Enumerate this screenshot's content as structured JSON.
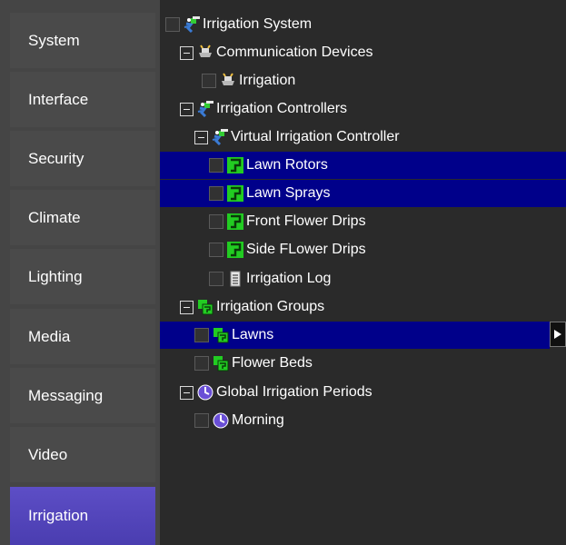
{
  "sidebar": {
    "items": [
      {
        "label": "System"
      },
      {
        "label": "Interface"
      },
      {
        "label": "Security"
      },
      {
        "label": "Climate"
      },
      {
        "label": "Lighting"
      },
      {
        "label": "Media"
      },
      {
        "label": "Messaging"
      },
      {
        "label": "Video"
      },
      {
        "label": "Irrigation",
        "active": true
      }
    ]
  },
  "tree": {
    "rows": [
      {
        "label": "Irrigation System",
        "icon": "sprinkler-icon",
        "level": 0,
        "control": "checkbox"
      },
      {
        "label": "Communication Devices",
        "icon": "device-icon",
        "level": 1,
        "control": "expander"
      },
      {
        "label": "Irrigation",
        "icon": "device-icon",
        "level": 2,
        "control": "checkbox"
      },
      {
        "label": "Irrigation Controllers",
        "icon": "sprinkler-icon",
        "level": 1,
        "control": "expander"
      },
      {
        "label": "Virtual Irrigation Controller",
        "icon": "sprinkler-icon",
        "level": 2,
        "control": "expander"
      },
      {
        "label": "Lawn Rotors",
        "icon": "valve-icon",
        "level": 3,
        "control": "checkbox",
        "selected": true
      },
      {
        "label": "Lawn Sprays",
        "icon": "valve-icon",
        "level": 3,
        "control": "checkbox",
        "selected": true
      },
      {
        "label": "Front Flower Drips",
        "icon": "valve-icon",
        "level": 3,
        "control": "checkbox"
      },
      {
        "label": "Side FLower Drips",
        "icon": "valve-icon",
        "level": 3,
        "control": "checkbox"
      },
      {
        "label": "Irrigation Log",
        "icon": "log-icon",
        "level": 3,
        "control": "checkbox"
      },
      {
        "label": "Irrigation Groups",
        "icon": "group-icon",
        "level": 1,
        "control": "expander"
      },
      {
        "label": "Lawns",
        "icon": "group-icon",
        "level": 2,
        "control": "checkbox",
        "selected": true
      },
      {
        "label": "Flower Beds",
        "icon": "group-icon",
        "level": 2,
        "control": "checkbox"
      },
      {
        "label": "Global Irrigation Periods",
        "icon": "clock-icon",
        "level": 1,
        "control": "expander"
      },
      {
        "label": "Morning",
        "icon": "clock-icon",
        "level": 2,
        "control": "checkbox"
      }
    ]
  },
  "colors": {
    "selection": "#00008a",
    "sidebar_active": "#5d4ec6",
    "valve_green": "#22cc22"
  }
}
